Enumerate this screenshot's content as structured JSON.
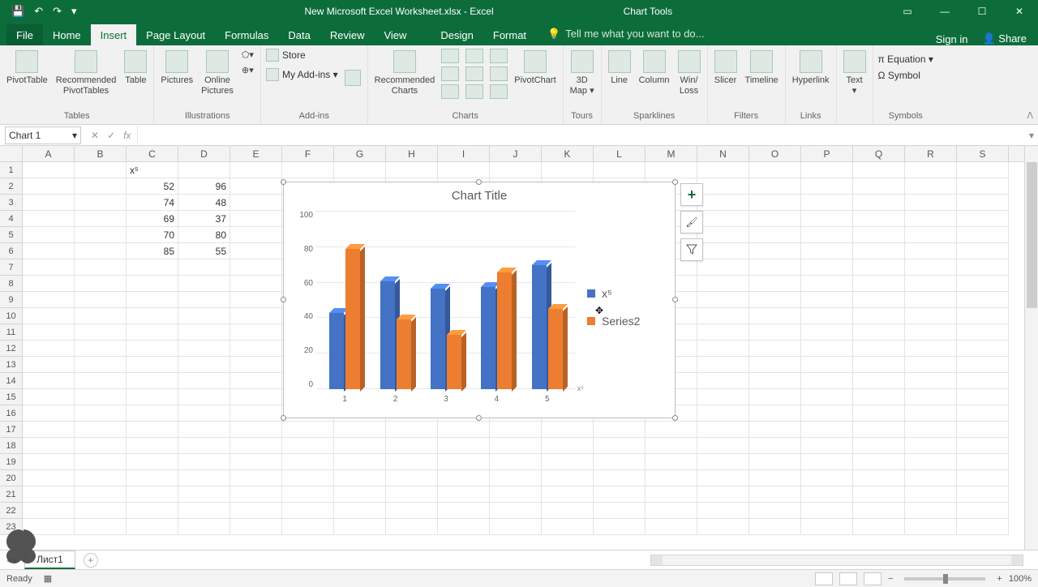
{
  "app": {
    "doc_title": "New Microsoft Excel Worksheet.xlsx - Excel",
    "tool_context": "Chart Tools"
  },
  "window_controls": {
    "ribbon_opts": "▭",
    "min": "—",
    "max": "☐",
    "close": "✕"
  },
  "qat": {
    "save": "💾",
    "undo": "↶",
    "redo": "↷",
    "more": "▾"
  },
  "tabs": {
    "file": "File",
    "home": "Home",
    "insert": "Insert",
    "page_layout": "Page Layout",
    "formulas": "Formulas",
    "data": "Data",
    "review": "Review",
    "view": "View",
    "design": "Design",
    "format": "Format"
  },
  "tellme": {
    "prompt": "Tell me what you want to do..."
  },
  "account": {
    "signin": "Sign in",
    "share": "Share"
  },
  "ribbon": {
    "tables": {
      "pivot": "PivotTable",
      "recpivot": "Recommended\nPivotTables",
      "table": "Table",
      "label": "Tables"
    },
    "illus": {
      "pictures": "Pictures",
      "online": "Online\nPictures",
      "shapes": "⬠▾",
      "plus": "⊕▾",
      "label": "Illustrations"
    },
    "addins": {
      "store": "Store",
      "myaddins": "My Add-ins ▾",
      "label": "Add-ins"
    },
    "charts": {
      "rec": "Recommended\nCharts",
      "pivotchart": "PivotChart",
      "label": "Charts"
    },
    "tours": {
      "map": "3D\nMap ▾",
      "label": "Tours"
    },
    "spark": {
      "line": "Line",
      "column": "Column",
      "winloss": "Win/\nLoss",
      "label": "Sparklines"
    },
    "filters": {
      "slicer": "Slicer",
      "timeline": "Timeline",
      "label": "Filters"
    },
    "links": {
      "hyper": "Hyperlink",
      "label": "Links"
    },
    "text": {
      "text": "Text\n▾",
      "label": ""
    },
    "symbols": {
      "eq": "π Equation ▾",
      "sym": "Ω Symbol",
      "label": "Symbols"
    }
  },
  "formula_bar": {
    "name": "Chart 1",
    "fx": "fx",
    "cancel": "✕",
    "enter": "✓",
    "value": ""
  },
  "columns": [
    "A",
    "B",
    "C",
    "D",
    "E",
    "F",
    "G",
    "H",
    "I",
    "J",
    "K",
    "L",
    "M",
    "N",
    "O",
    "P",
    "Q",
    "R",
    "S"
  ],
  "sheet": {
    "header_C1": "x⁵",
    "rows": [
      {
        "r": 2,
        "C": "52",
        "D": "96"
      },
      {
        "r": 3,
        "C": "74",
        "D": "48"
      },
      {
        "r": 4,
        "C": "69",
        "D": "37"
      },
      {
        "r": 5,
        "C": "70",
        "D": "80"
      },
      {
        "r": 6,
        "C": "85",
        "D": "55"
      }
    ]
  },
  "chart_data": {
    "type": "bar",
    "title": "Chart Title",
    "categories": [
      "1",
      "2",
      "3",
      "4",
      "5"
    ],
    "series": [
      {
        "name": "x⁵",
        "color": "#4472C4",
        "values": [
          52,
          74,
          69,
          70,
          85
        ]
      },
      {
        "name": "Series2",
        "color": "#ED7D31",
        "values": [
          96,
          48,
          37,
          80,
          55
        ]
      }
    ],
    "ylabel": "",
    "xlabel": "",
    "ylim": [
      0,
      100
    ],
    "yticks": [
      "100",
      "80",
      "60",
      "40",
      "20",
      "0"
    ],
    "annotation": "x⁵",
    "legend_position": "right"
  },
  "chart_side_buttons": {
    "add": "+",
    "brush": "🖌",
    "filter": "▾"
  },
  "sheet_tabs": {
    "active": "Лист1"
  },
  "status": {
    "ready": "Ready",
    "zoom": "100%",
    "minus": "−",
    "plus": "+"
  }
}
